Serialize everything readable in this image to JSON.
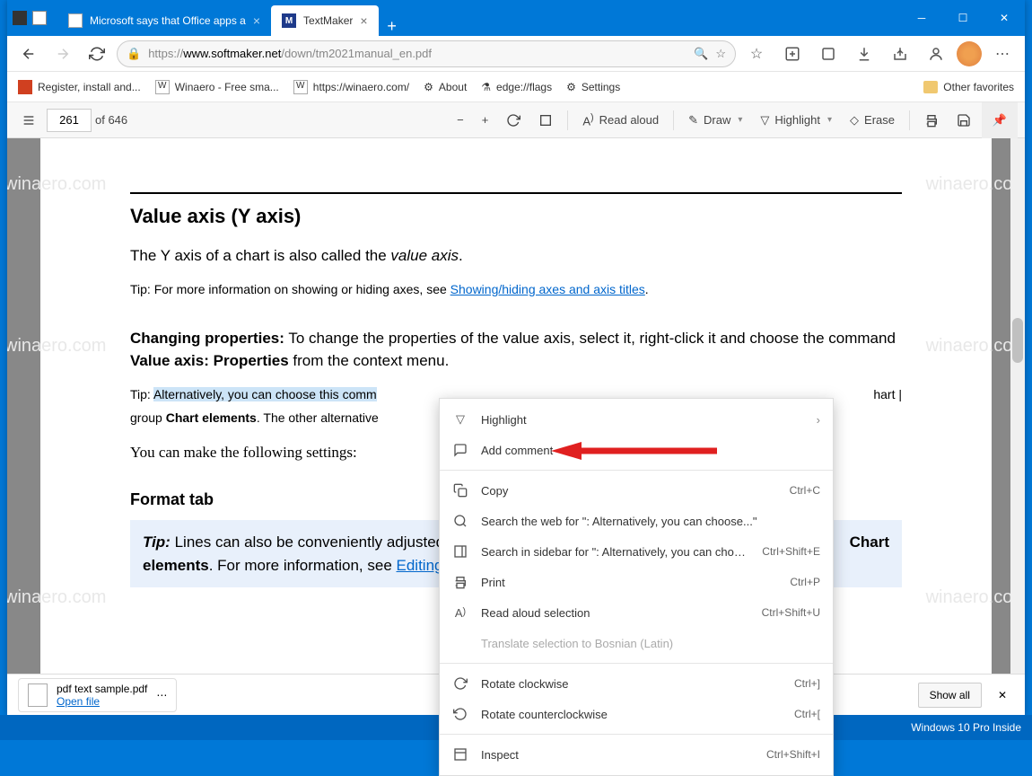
{
  "titlebar": {
    "tabs": [
      {
        "label": "Microsoft says that Office apps a",
        "active": false
      },
      {
        "label": "TextMaker",
        "active": true
      }
    ]
  },
  "address": {
    "url_prefix": "https://",
    "url_host": "www.softmaker.net",
    "url_path": "/down/tm2021manual_en.pdf"
  },
  "bookmarks": [
    {
      "label": "Register, install and...",
      "color": "#d04020"
    },
    {
      "label": "Winaero - Free sma...",
      "icon": "W"
    },
    {
      "label": "https://winaero.com/",
      "icon": "W"
    },
    {
      "label": "About"
    },
    {
      "label": "edge://flags"
    },
    {
      "label": "Settings"
    }
  ],
  "bookmarks_right": "Other favorites",
  "pdfbar": {
    "page": "261",
    "of": "of 646",
    "read_aloud": "Read aloud",
    "draw": "Draw",
    "highlight": "Highlight",
    "erase": "Erase"
  },
  "doc": {
    "h2": "Value axis (Y axis)",
    "p1_a": "The Y axis of a chart is also called the ",
    "p1_i": "value axis",
    "p1_b": ".",
    "p2_a": "Tip: For more information on showing or hiding axes, see  ",
    "p2_link": "Showing/hiding axes and axis titles",
    "p2_b": ".",
    "p3_b1": "Changing properties:",
    "p3_a": " To change the properties of the value axis, select it, right-click it and choose the command ",
    "p3_b2": "Value axis: Properties",
    "p3_c": " from the context menu.",
    "p4_a": "Tip: ",
    "p4_sel": "Alternatively, you can choose this comm",
    "p4_tail": "hart |",
    "p5_a": "group ",
    "p5_b": "Chart elements",
    "p5_c": ". The other alternative",
    "p6": "You can make the following settings:",
    "h3": "Format tab",
    "tip_b": "Tip:",
    "tip_a": " Lines can also be conveniently adjusted",
    "tip_chart": "Chart",
    "tip_el": "elements",
    "tip_c": ". For more information, see ",
    "tip_link": "Editing"
  },
  "ctx": {
    "highlight": "Highlight",
    "add_comment": "Add comment",
    "copy": "Copy",
    "copy_k": "Ctrl+C",
    "search_web": "Search the web for \": Alternatively, you can choose...\"",
    "search_side": "Search in sidebar for \": Alternatively, you can choose...\"",
    "search_side_k": "Ctrl+Shift+E",
    "print": "Print",
    "print_k": "Ctrl+P",
    "read": "Read aloud selection",
    "read_k": "Ctrl+Shift+U",
    "translate": "Translate selection to Bosnian (Latin)",
    "rot_cw": "Rotate clockwise",
    "rot_cw_k": "Ctrl+]",
    "rot_ccw": "Rotate counterclockwise",
    "rot_ccw_k": "Ctrl+[",
    "inspect": "Inspect",
    "inspect_k": "Ctrl+Shift+I"
  },
  "download": {
    "filename": "pdf text sample.pdf",
    "open": "Open file",
    "showall": "Show all"
  },
  "taskbar": "Windows 10 Pro Inside"
}
